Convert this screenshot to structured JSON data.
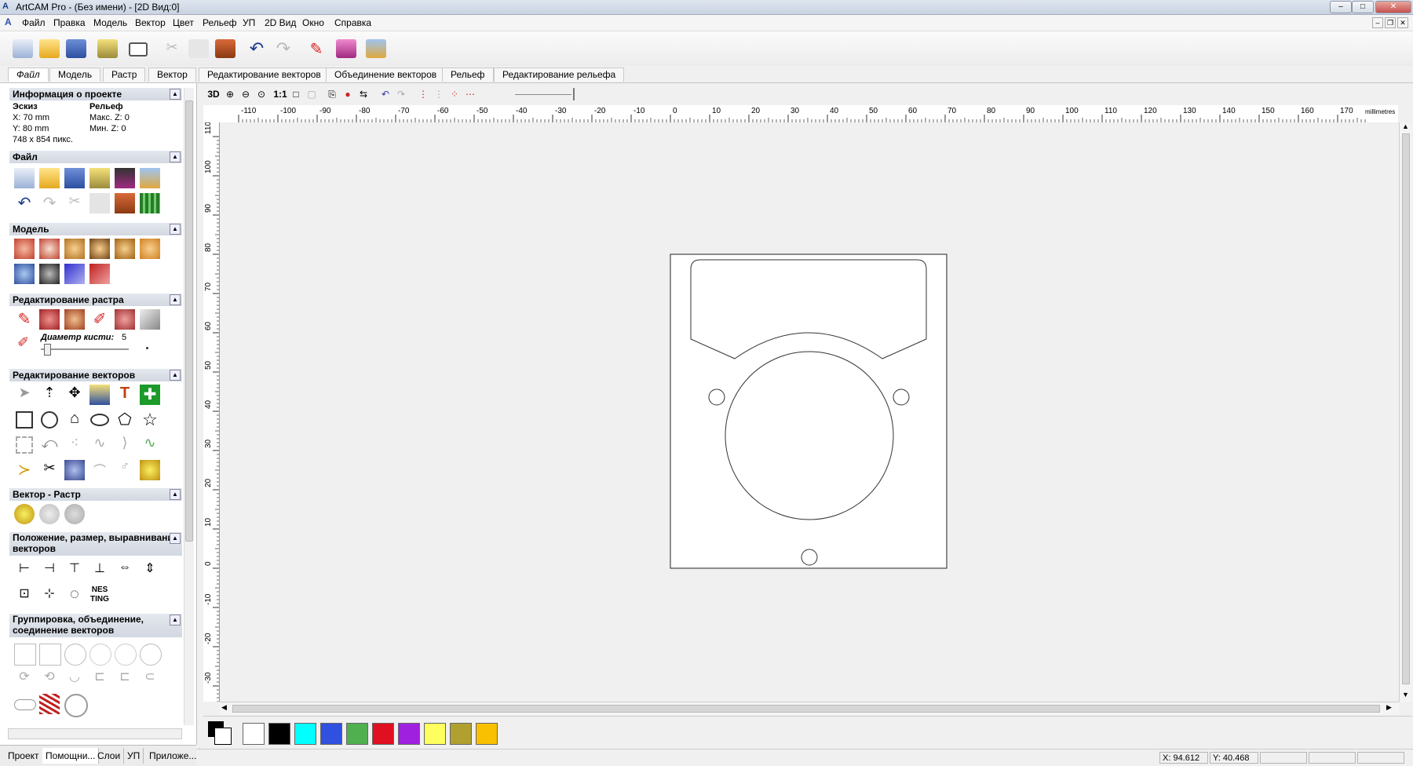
{
  "window": {
    "title": "ArtCAM Pro - (Без имени) - [2D Вид:0]",
    "controls": [
      "minimize",
      "maximize",
      "close"
    ]
  },
  "menu": [
    "Файл",
    "Правка",
    "Модель",
    "Вектор",
    "Цвет",
    "Рельеф",
    "УП",
    "2D Вид",
    "Окно",
    "Справка"
  ],
  "toolbar_icons": [
    "new-file-icon",
    "open-folder-icon",
    "save-icon",
    "load-model-icon",
    "display-window-icon",
    "cut-icon",
    "copy-icon",
    "paste-icon",
    "undo-icon",
    "redo-icon",
    "pen-icon",
    "eraser-icon",
    "3d-view-icon"
  ],
  "ribbon_tabs": [
    "Файл",
    "Модель",
    "Растр",
    "Вектор",
    "Редактирование векторов",
    "Объединение векторов",
    "Рельеф",
    "Редактирование рельефа"
  ],
  "project_info": {
    "header": "Информация о проекте",
    "sketch_label": "Эскиз",
    "relief_label": "Рельеф",
    "x": "X: 70 mm",
    "y": "Y: 80 mm",
    "pixels": "748 x 854 пикс.",
    "max_z": "Макс. Z: 0",
    "min_z": "Мин. Z: 0"
  },
  "sections": {
    "file": "Файл",
    "model": "Модель",
    "raster_edit": "Редактирование растра",
    "brush_label": "Диаметр кисти:",
    "brush_value": "5",
    "vector_edit": "Редактирование векторов",
    "vector_raster": "Вектор - Растр",
    "position": "Положение, размер, выравнивание векторов",
    "grouping": "Группировка, объединение, соединение векторов"
  },
  "bottom_tabs": [
    "Проект",
    "Помощни...",
    "Слои",
    "УП",
    "Приложе..."
  ],
  "view_toolbar": {
    "label_3d": "3D",
    "label_11": "1:1"
  },
  "ruler": {
    "units": "millimetres",
    "h_ticks": [
      "-110",
      "-100",
      "-90",
      "-80",
      "-70",
      "-60",
      "-50",
      "-40",
      "-30",
      "-20",
      "-10",
      "0",
      "10",
      "20",
      "30",
      "40",
      "50",
      "60",
      "70",
      "80",
      "90",
      "100",
      "110",
      "120",
      "130",
      "140",
      "150",
      "160",
      "170"
    ],
    "v_ticks": [
      "110",
      "100",
      "90",
      "80",
      "70",
      "60",
      "50",
      "40",
      "30",
      "20",
      "10",
      "0",
      "-10",
      "-20",
      "-30"
    ]
  },
  "palette_colors": [
    "#ffffff",
    "#000000",
    "#00ffff",
    "#3050e0",
    "#50b050",
    "#e01020",
    "#a020e0",
    "#ffff60",
    "#b0a030",
    "#f8c000"
  ],
  "status": {
    "x": "X: 94.612",
    "y": "Y: 40.468"
  }
}
